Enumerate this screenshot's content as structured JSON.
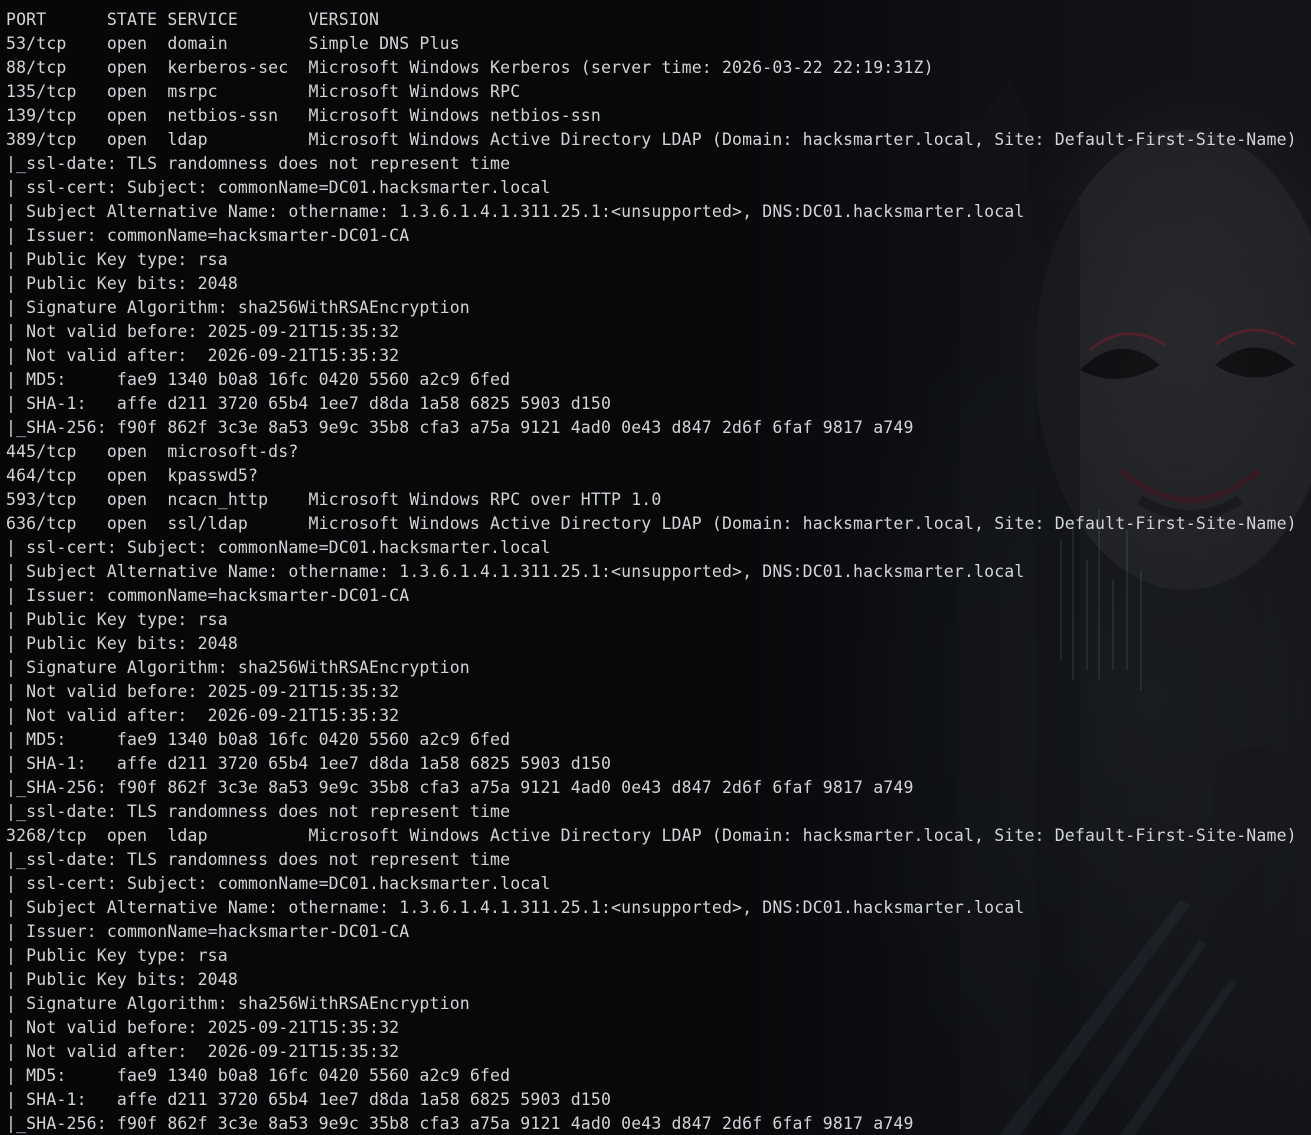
{
  "terminal": {
    "lines": [
      "PORT      STATE SERVICE       VERSION",
      "53/tcp    open  domain        Simple DNS Plus",
      "88/tcp    open  kerberos-sec  Microsoft Windows Kerberos (server time: 2026-03-22 22:19:31Z)",
      "135/tcp   open  msrpc         Microsoft Windows RPC",
      "139/tcp   open  netbios-ssn   Microsoft Windows netbios-ssn",
      "389/tcp   open  ldap          Microsoft Windows Active Directory LDAP (Domain: hacksmarter.local, Site: Default-First-Site-Name)",
      "|_ssl-date: TLS randomness does not represent time",
      "| ssl-cert: Subject: commonName=DC01.hacksmarter.local",
      "| Subject Alternative Name: othername: 1.3.6.1.4.1.311.25.1:<unsupported>, DNS:DC01.hacksmarter.local",
      "| Issuer: commonName=hacksmarter-DC01-CA",
      "| Public Key type: rsa",
      "| Public Key bits: 2048",
      "| Signature Algorithm: sha256WithRSAEncryption",
      "| Not valid before: 2025-09-21T15:35:32",
      "| Not valid after:  2026-09-21T15:35:32",
      "| MD5:     fae9 1340 b0a8 16fc 0420 5560 a2c9 6fed",
      "| SHA-1:   affe d211 3720 65b4 1ee7 d8da 1a58 6825 5903 d150",
      "|_SHA-256: f90f 862f 3c3e 8a53 9e9c 35b8 cfa3 a75a 9121 4ad0 0e43 d847 2d6f 6faf 9817 a749",
      "445/tcp   open  microsoft-ds?",
      "464/tcp   open  kpasswd5?",
      "593/tcp   open  ncacn_http    Microsoft Windows RPC over HTTP 1.0",
      "636/tcp   open  ssl/ldap      Microsoft Windows Active Directory LDAP (Domain: hacksmarter.local, Site: Default-First-Site-Name)",
      "| ssl-cert: Subject: commonName=DC01.hacksmarter.local",
      "| Subject Alternative Name: othername: 1.3.6.1.4.1.311.25.1:<unsupported>, DNS:DC01.hacksmarter.local",
      "| Issuer: commonName=hacksmarter-DC01-CA",
      "| Public Key type: rsa",
      "| Public Key bits: 2048",
      "| Signature Algorithm: sha256WithRSAEncryption",
      "| Not valid before: 2025-09-21T15:35:32",
      "| Not valid after:  2026-09-21T15:35:32",
      "| MD5:     fae9 1340 b0a8 16fc 0420 5560 a2c9 6fed",
      "| SHA-1:   affe d211 3720 65b4 1ee7 d8da 1a58 6825 5903 d150",
      "|_SHA-256: f90f 862f 3c3e 8a53 9e9c 35b8 cfa3 a75a 9121 4ad0 0e43 d847 2d6f 6faf 9817 a749",
      "|_ssl-date: TLS randomness does not represent time",
      "3268/tcp  open  ldap          Microsoft Windows Active Directory LDAP (Domain: hacksmarter.local, Site: Default-First-Site-Name)",
      "|_ssl-date: TLS randomness does not represent time",
      "| ssl-cert: Subject: commonName=DC01.hacksmarter.local",
      "| Subject Alternative Name: othername: 1.3.6.1.4.1.311.25.1:<unsupported>, DNS:DC01.hacksmarter.local",
      "| Issuer: commonName=hacksmarter-DC01-CA",
      "| Public Key type: rsa",
      "| Public Key bits: 2048",
      "| Signature Algorithm: sha256WithRSAEncryption",
      "| Not valid before: 2025-09-21T15:35:32",
      "| Not valid after:  2026-09-21T15:35:32",
      "| MD5:     fae9 1340 b0a8 16fc 0420 5560 a2c9 6fed",
      "| SHA-1:   affe d211 3720 65b4 1ee7 d8da 1a58 6825 5903 d150",
      "|_SHA-256: f90f 862f 3c3e 8a53 9e9c 35b8 cfa3 a75a 9121 4ad0 0e43 d847 2d6f 6faf 9817 a749"
    ]
  },
  "colors": {
    "background": "#0a0b0d",
    "text": "#d2d4d6"
  }
}
